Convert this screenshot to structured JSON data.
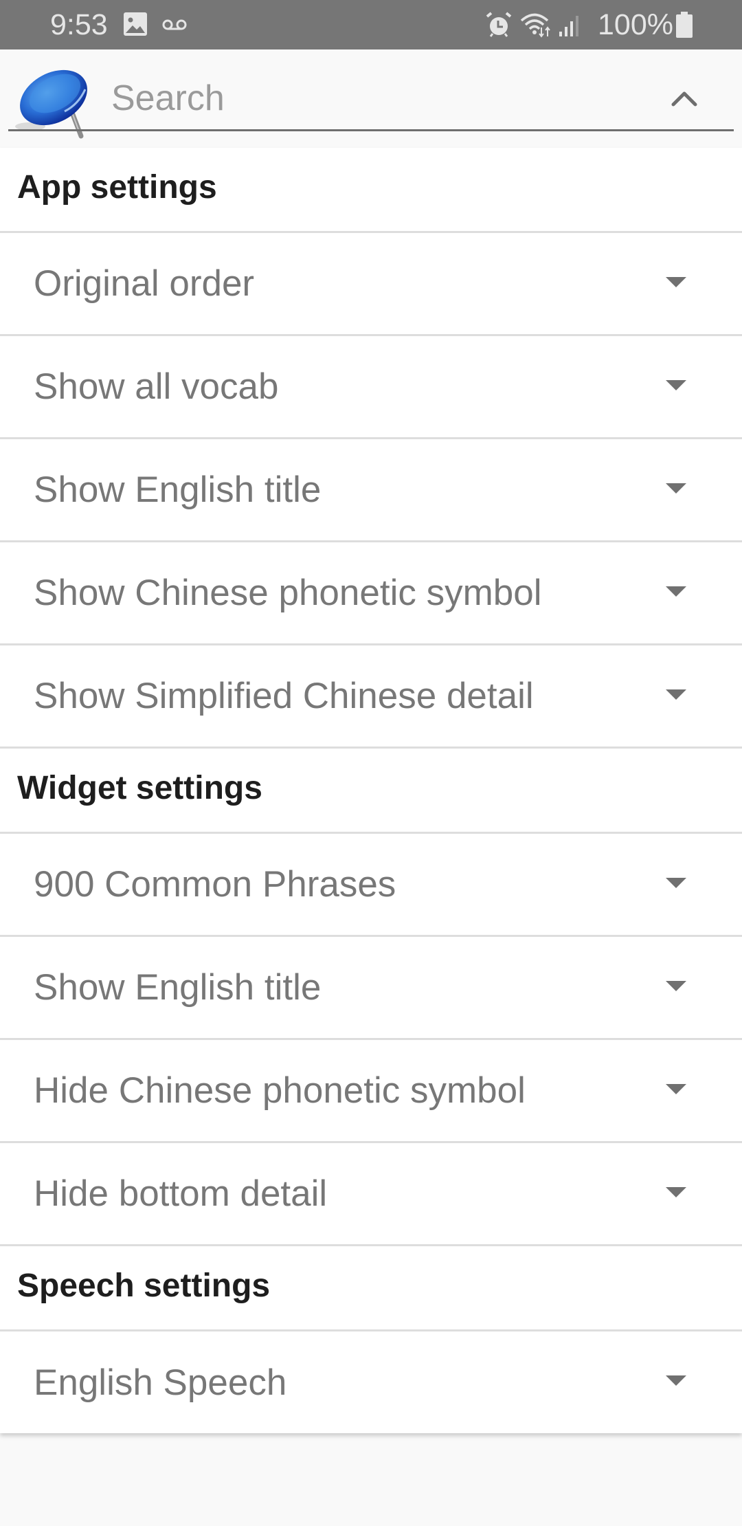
{
  "status_bar": {
    "time": "9:53",
    "left_icons": [
      "image-icon",
      "voicemail-icon"
    ],
    "right_icons": [
      "alarm-icon",
      "wifi-icon",
      "signal-icon"
    ],
    "battery_percent": "100%",
    "battery_icon": "battery-full-icon"
  },
  "header": {
    "logo_icon": "pushpin-icon",
    "search_placeholder": "Search",
    "search_value": "",
    "collapse_icon": "chevron-up-icon"
  },
  "colors": {
    "status_bar_bg": "#767676",
    "section_title": "#1e1e1e",
    "row_text": "#777777",
    "divider": "#dddddd",
    "pin_blue": "#1e5fd0"
  },
  "sections": [
    {
      "title": "App settings",
      "items": [
        {
          "label": "Original order"
        },
        {
          "label": "Show all vocab"
        },
        {
          "label": "Show English title"
        },
        {
          "label": "Show Chinese phonetic symbol"
        },
        {
          "label": "Show Simplified Chinese detail"
        }
      ]
    },
    {
      "title": "Widget settings",
      "items": [
        {
          "label": "900 Common Phrases"
        },
        {
          "label": "Show English title"
        },
        {
          "label": "Hide Chinese phonetic symbol"
        },
        {
          "label": "Hide bottom detail"
        }
      ]
    },
    {
      "title": "Speech settings",
      "items": [
        {
          "label": "English Speech"
        }
      ]
    }
  ]
}
